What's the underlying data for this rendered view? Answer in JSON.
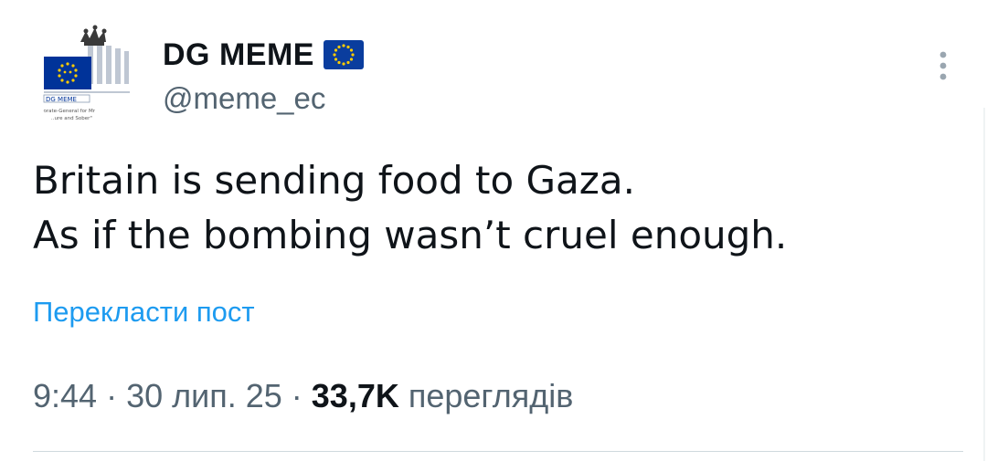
{
  "author": {
    "display_name": "DG MEME",
    "handle": "@meme_ec",
    "flag_icon": "eu-flag-icon",
    "avatar": {
      "label": "DG MEME",
      "subtitle_line1": "…orate-General for Mr",
      "subtitle_line2": "…ure and Sober\""
    }
  },
  "tweet": {
    "lines": [
      "Britain is sending food to Gaza.",
      "As if the bombing wasn’t cruel enough."
    ]
  },
  "translate_label": "Перекласти пост",
  "meta": {
    "time": "9:44",
    "separator": " · ",
    "date": "30 лип. 25",
    "views_count": "33,7K",
    "views_label": " переглядів"
  },
  "colors": {
    "link": "#1d9bf0",
    "secondary_text": "#536471",
    "eu_blue": "#003399",
    "eu_gold": "#ffcc00"
  }
}
